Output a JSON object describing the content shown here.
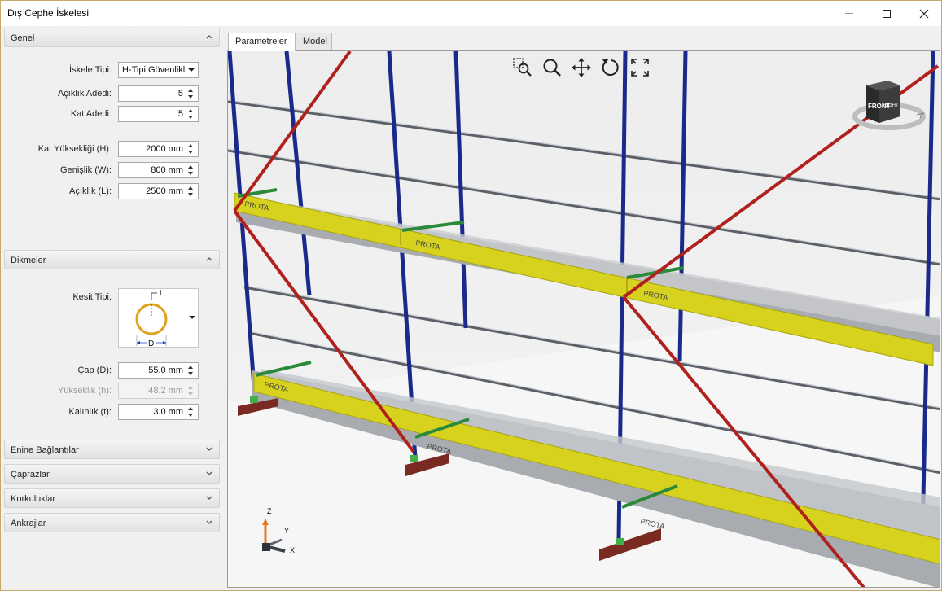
{
  "window": {
    "title": "Dış Cephe İskelesi",
    "controls": {
      "minimize": "",
      "maximize": "",
      "close": "✕"
    }
  },
  "sections": {
    "genel": {
      "label": "Genel",
      "expanded": true
    },
    "dikmeler": {
      "label": "Dikmeler",
      "expanded": true
    },
    "enine": {
      "label": "Enine Bağlantılar",
      "expanded": false
    },
    "caprazlar": {
      "label": "Çaprazlar",
      "expanded": false
    },
    "korkuluklar": {
      "label": "Korkuluklar",
      "expanded": false
    },
    "ankrajlar": {
      "label": "Ankrajlar",
      "expanded": false
    }
  },
  "genel": {
    "iskele_tipi": {
      "label": "İskele Tipi:",
      "value": "H-Tipi Güvenlikli"
    },
    "aciklik_adedi": {
      "label": "Açıklık Adedi:",
      "value": "5"
    },
    "kat_adedi": {
      "label": "Kat Adedi:",
      "value": "5"
    },
    "kat_yuksekligi": {
      "label": "Kat Yüksekliği (H):",
      "value": "2000 mm"
    },
    "genislik": {
      "label": "Genişlik (W):",
      "value": "800 mm"
    },
    "aciklik": {
      "label": "Açıklık (L):",
      "value": "2500 mm"
    }
  },
  "dikmeler": {
    "kesit_tipi": {
      "label": "Kesit Tipi:",
      "diagram_t": "t",
      "diagram_d": "D"
    },
    "cap": {
      "label": "Çap (D):",
      "value": "55.0 mm"
    },
    "yukseklik": {
      "label": "Yükseklik (h):",
      "value": "48.2 mm",
      "disabled": true
    },
    "kalinlik": {
      "label": "Kalınlık (t):",
      "value": "3.0 mm"
    }
  },
  "tabs": [
    {
      "label": "Parametreler",
      "active": true
    },
    {
      "label": "Model",
      "active": false
    }
  ],
  "viewport": {
    "tools": [
      "zoom-window-icon",
      "zoom-icon",
      "pan-icon",
      "rotate-icon",
      "fit-extents-icon"
    ],
    "navcube": {
      "face": "FRONT",
      "side": "RIGHT"
    },
    "axes": {
      "z": "Z",
      "y": "Y",
      "x": "X"
    },
    "plank_label": "PROTA",
    "colors": {
      "uprights": "#1a2a8c",
      "diagonal": "#b0201c",
      "toeboard": "#d6d21e",
      "rail": "#9aa3ad",
      "base": "#7a2a22",
      "connector": "#2a8a3a"
    }
  }
}
